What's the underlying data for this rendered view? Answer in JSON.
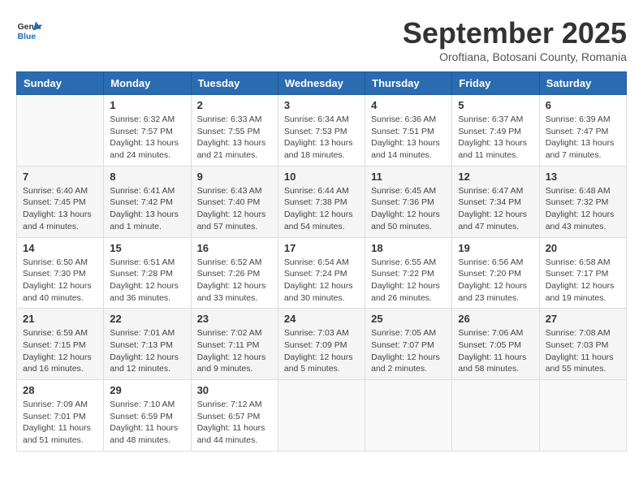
{
  "header": {
    "logo_line1": "General",
    "logo_line2": "Blue",
    "month_title": "September 2025",
    "subtitle": "Oroftiana, Botosani County, Romania"
  },
  "days_of_week": [
    "Sunday",
    "Monday",
    "Tuesday",
    "Wednesday",
    "Thursday",
    "Friday",
    "Saturday"
  ],
  "weeks": [
    [
      {
        "day": "",
        "info": ""
      },
      {
        "day": "1",
        "info": "Sunrise: 6:32 AM\nSunset: 7:57 PM\nDaylight: 13 hours\nand 24 minutes."
      },
      {
        "day": "2",
        "info": "Sunrise: 6:33 AM\nSunset: 7:55 PM\nDaylight: 13 hours\nand 21 minutes."
      },
      {
        "day": "3",
        "info": "Sunrise: 6:34 AM\nSunset: 7:53 PM\nDaylight: 13 hours\nand 18 minutes."
      },
      {
        "day": "4",
        "info": "Sunrise: 6:36 AM\nSunset: 7:51 PM\nDaylight: 13 hours\nand 14 minutes."
      },
      {
        "day": "5",
        "info": "Sunrise: 6:37 AM\nSunset: 7:49 PM\nDaylight: 13 hours\nand 11 minutes."
      },
      {
        "day": "6",
        "info": "Sunrise: 6:39 AM\nSunset: 7:47 PM\nDaylight: 13 hours\nand 7 minutes."
      }
    ],
    [
      {
        "day": "7",
        "info": "Sunrise: 6:40 AM\nSunset: 7:45 PM\nDaylight: 13 hours\nand 4 minutes."
      },
      {
        "day": "8",
        "info": "Sunrise: 6:41 AM\nSunset: 7:42 PM\nDaylight: 13 hours\nand 1 minute."
      },
      {
        "day": "9",
        "info": "Sunrise: 6:43 AM\nSunset: 7:40 PM\nDaylight: 12 hours\nand 57 minutes."
      },
      {
        "day": "10",
        "info": "Sunrise: 6:44 AM\nSunset: 7:38 PM\nDaylight: 12 hours\nand 54 minutes."
      },
      {
        "day": "11",
        "info": "Sunrise: 6:45 AM\nSunset: 7:36 PM\nDaylight: 12 hours\nand 50 minutes."
      },
      {
        "day": "12",
        "info": "Sunrise: 6:47 AM\nSunset: 7:34 PM\nDaylight: 12 hours\nand 47 minutes."
      },
      {
        "day": "13",
        "info": "Sunrise: 6:48 AM\nSunset: 7:32 PM\nDaylight: 12 hours\nand 43 minutes."
      }
    ],
    [
      {
        "day": "14",
        "info": "Sunrise: 6:50 AM\nSunset: 7:30 PM\nDaylight: 12 hours\nand 40 minutes."
      },
      {
        "day": "15",
        "info": "Sunrise: 6:51 AM\nSunset: 7:28 PM\nDaylight: 12 hours\nand 36 minutes."
      },
      {
        "day": "16",
        "info": "Sunrise: 6:52 AM\nSunset: 7:26 PM\nDaylight: 12 hours\nand 33 minutes."
      },
      {
        "day": "17",
        "info": "Sunrise: 6:54 AM\nSunset: 7:24 PM\nDaylight: 12 hours\nand 30 minutes."
      },
      {
        "day": "18",
        "info": "Sunrise: 6:55 AM\nSunset: 7:22 PM\nDaylight: 12 hours\nand 26 minutes."
      },
      {
        "day": "19",
        "info": "Sunrise: 6:56 AM\nSunset: 7:20 PM\nDaylight: 12 hours\nand 23 minutes."
      },
      {
        "day": "20",
        "info": "Sunrise: 6:58 AM\nSunset: 7:17 PM\nDaylight: 12 hours\nand 19 minutes."
      }
    ],
    [
      {
        "day": "21",
        "info": "Sunrise: 6:59 AM\nSunset: 7:15 PM\nDaylight: 12 hours\nand 16 minutes."
      },
      {
        "day": "22",
        "info": "Sunrise: 7:01 AM\nSunset: 7:13 PM\nDaylight: 12 hours\nand 12 minutes."
      },
      {
        "day": "23",
        "info": "Sunrise: 7:02 AM\nSunset: 7:11 PM\nDaylight: 12 hours\nand 9 minutes."
      },
      {
        "day": "24",
        "info": "Sunrise: 7:03 AM\nSunset: 7:09 PM\nDaylight: 12 hours\nand 5 minutes."
      },
      {
        "day": "25",
        "info": "Sunrise: 7:05 AM\nSunset: 7:07 PM\nDaylight: 12 hours\nand 2 minutes."
      },
      {
        "day": "26",
        "info": "Sunrise: 7:06 AM\nSunset: 7:05 PM\nDaylight: 11 hours\nand 58 minutes."
      },
      {
        "day": "27",
        "info": "Sunrise: 7:08 AM\nSunset: 7:03 PM\nDaylight: 11 hours\nand 55 minutes."
      }
    ],
    [
      {
        "day": "28",
        "info": "Sunrise: 7:09 AM\nSunset: 7:01 PM\nDaylight: 11 hours\nand 51 minutes."
      },
      {
        "day": "29",
        "info": "Sunrise: 7:10 AM\nSunset: 6:59 PM\nDaylight: 11 hours\nand 48 minutes."
      },
      {
        "day": "30",
        "info": "Sunrise: 7:12 AM\nSunset: 6:57 PM\nDaylight: 11 hours\nand 44 minutes."
      },
      {
        "day": "",
        "info": ""
      },
      {
        "day": "",
        "info": ""
      },
      {
        "day": "",
        "info": ""
      },
      {
        "day": "",
        "info": ""
      }
    ]
  ]
}
